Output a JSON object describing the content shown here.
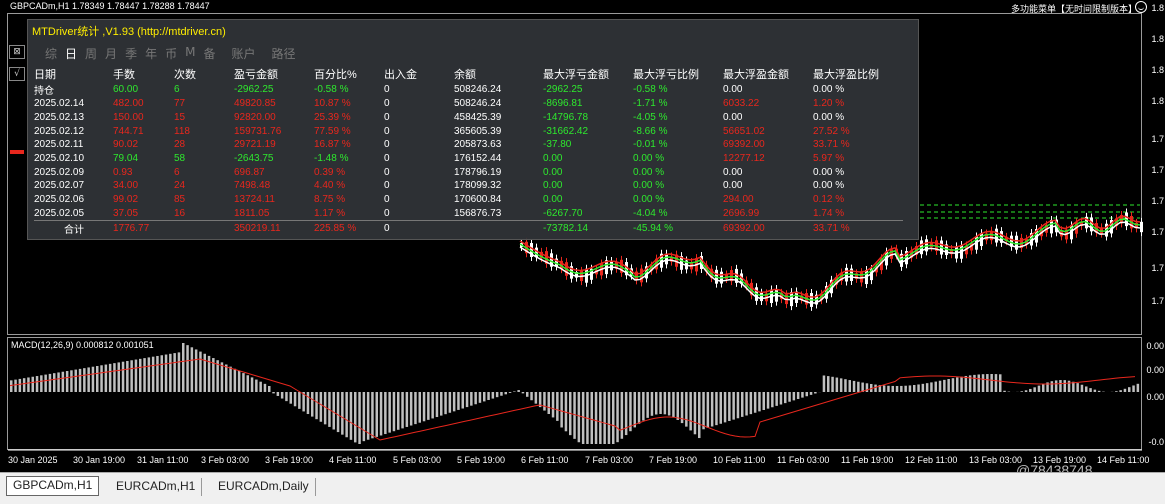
{
  "header": {
    "symbol_info": "GBPCADm,H1  1.78349 1.78447 1.78288 1.78447",
    "right_text": "多功能菜单【无时间限制版本】"
  },
  "macd": {
    "label": "MACD(12,26,9) 0.000812 0.001051"
  },
  "price_axis": [
    "1.8",
    "1.8",
    "1.8",
    "1.8",
    "1.7",
    "1.7",
    "1.7",
    "1.7",
    "1.7",
    "1.7"
  ],
  "macd_axis": [
    "0.00",
    "0.00",
    "0.00",
    "-0.0"
  ],
  "x_axis": [
    "30 Jan 2025",
    "30 Jan 19:00",
    "31 Jan 11:00",
    "3 Feb 03:00",
    "3 Feb 19:00",
    "4 Feb 11:00",
    "5 Feb 03:00",
    "5 Feb 19:00",
    "6 Feb 11:00",
    "7 Feb 03:00",
    "7 Feb 19:00",
    "10 Feb 11:00",
    "11 Feb 03:00",
    "11 Feb 19:00",
    "12 Feb 11:00",
    "13 Feb 03:00",
    "13 Feb 19:00",
    "14 Feb 11:00"
  ],
  "watermark": "@78438748",
  "panel": {
    "title": "MTDriver统计 ,V1.93 (http://mtdriver.cn)",
    "tabs": [
      "综",
      "日",
      "周",
      "月",
      "季",
      "年",
      "币",
      "M",
      "备",
      "账户",
      "路径"
    ],
    "active_tab": "日",
    "columns": [
      "日期",
      "手数",
      "次数",
      "盈亏金额",
      "百分比%",
      "出入金",
      "余额",
      "最大浮亏金额",
      "最大浮亏比例",
      "最大浮盈金额",
      "最大浮盈比例"
    ],
    "rows": [
      {
        "date": "持仓",
        "lots": "60.00",
        "count": "6",
        "pnl": "-2962.25",
        "pct": "-0.58 %",
        "io": "0",
        "bal": "508246.24",
        "mfl": "-2962.25",
        "mflp": "-0.58 %",
        "mfp": "0.00",
        "mfpp": "0.00 %",
        "sign": "neg"
      },
      {
        "date": "2025.02.14",
        "lots": "482.00",
        "count": "77",
        "pnl": "49820.85",
        "pct": "10.87 %",
        "io": "0",
        "bal": "508246.24",
        "mfl": "-8696.81",
        "mflp": "-1.71 %",
        "mfp": "6033.22",
        "mfpp": "1.20 %",
        "sign": "pos"
      },
      {
        "date": "2025.02.13",
        "lots": "150.00",
        "count": "15",
        "pnl": "92820.00",
        "pct": "25.39 %",
        "io": "0",
        "bal": "458425.39",
        "mfl": "-14796.78",
        "mflp": "-4.05 %",
        "mfp": "0.00",
        "mfpp": "0.00 %",
        "sign": "pos"
      },
      {
        "date": "2025.02.12",
        "lots": "744.71",
        "count": "118",
        "pnl": "159731.76",
        "pct": "77.59 %",
        "io": "0",
        "bal": "365605.39",
        "mfl": "-31662.42",
        "mflp": "-8.66 %",
        "mfp": "56651.02",
        "mfpp": "27.52 %",
        "sign": "pos"
      },
      {
        "date": "2025.02.11",
        "lots": "90.02",
        "count": "28",
        "pnl": "29721.19",
        "pct": "16.87 %",
        "io": "0",
        "bal": "205873.63",
        "mfl": "-37.80",
        "mflp": "-0.01 %",
        "mfp": "69392.00",
        "mfpp": "33.71 %",
        "sign": "pos"
      },
      {
        "date": "2025.02.10",
        "lots": "79.04",
        "count": "58",
        "pnl": "-2643.75",
        "pct": "-1.48 %",
        "io": "0",
        "bal": "176152.44",
        "mfl": "0.00",
        "mflp": "0.00 %",
        "mfp": "12277.12",
        "mfpp": "5.97 %",
        "sign": "neg"
      },
      {
        "date": "2025.02.09",
        "lots": "0.93",
        "count": "6",
        "pnl": "696.87",
        "pct": "0.39 %",
        "io": "0",
        "bal": "178796.19",
        "mfl": "0.00",
        "mflp": "0.00 %",
        "mfp": "0.00",
        "mfpp": "0.00 %",
        "sign": "pos"
      },
      {
        "date": "2025.02.07",
        "lots": "34.00",
        "count": "24",
        "pnl": "7498.48",
        "pct": "4.40 %",
        "io": "0",
        "bal": "178099.32",
        "mfl": "0.00",
        "mflp": "0.00 %",
        "mfp": "0.00",
        "mfpp": "0.00 %",
        "sign": "pos"
      },
      {
        "date": "2025.02.06",
        "lots": "99.02",
        "count": "85",
        "pnl": "13724.11",
        "pct": "8.75 %",
        "io": "0",
        "bal": "170600.84",
        "mfl": "0.00",
        "mflp": "0.00 %",
        "mfp": "294.00",
        "mfpp": "0.12 %",
        "sign": "pos"
      },
      {
        "date": "2025.02.05",
        "lots": "37.05",
        "count": "16",
        "pnl": "1811.05",
        "pct": "1.17 %",
        "io": "0",
        "bal": "156876.73",
        "mfl": "-6267.70",
        "mflp": "-4.04 %",
        "mfp": "2696.99",
        "mfpp": "1.74 %",
        "sign": "pos"
      }
    ],
    "total": {
      "label": "合计",
      "lots": "1776.77",
      "pnl": "350219.11",
      "pct": "225.85 %",
      "io": "0",
      "mfl": "-73782.14",
      "mflp": "-45.94 %",
      "mfp": "69392.00",
      "mfpp": "33.71 %"
    }
  },
  "tabs": [
    "GBPCADm,H1",
    "EURCADm,H1",
    "EURCADm,Daily"
  ],
  "colors": {
    "up": "#e8271d",
    "down": "#ffffff",
    "ma1": "#ffffff",
    "ma2": "#2ee82e",
    "ma3": "#e8271d",
    "signal": "#e8271d",
    "hist": "#c0c0c0"
  }
}
